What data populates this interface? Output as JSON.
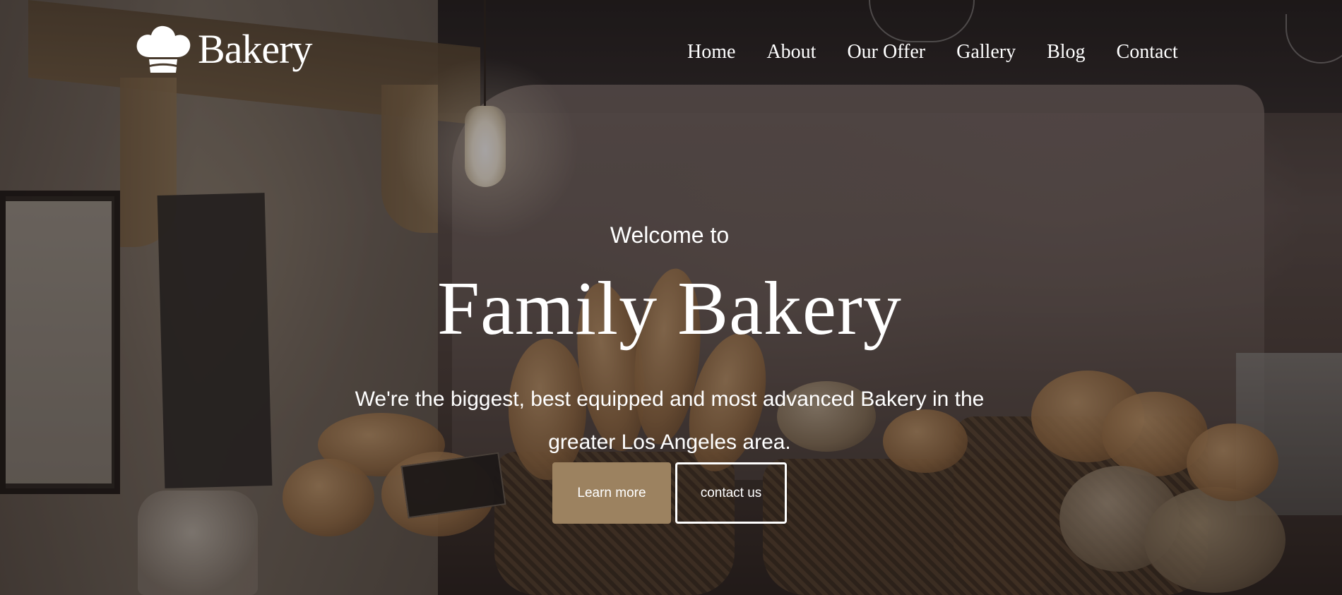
{
  "brand": {
    "name": "Bakery",
    "icon": "chef-hat-icon"
  },
  "nav": {
    "items": [
      {
        "label": "Home"
      },
      {
        "label": "About"
      },
      {
        "label": "Our Offer"
      },
      {
        "label": "Gallery"
      },
      {
        "label": "Blog"
      },
      {
        "label": "Contact"
      }
    ]
  },
  "hero": {
    "welcome": "Welcome to",
    "title": "Family Bakery",
    "subtitle": "We're the biggest, best equipped and most advanced Bakery in the greater Los Angeles area.",
    "primary_button": "Learn more",
    "secondary_button": "contact us"
  },
  "colors": {
    "accent": "#9c8260",
    "text": "#ffffff"
  }
}
